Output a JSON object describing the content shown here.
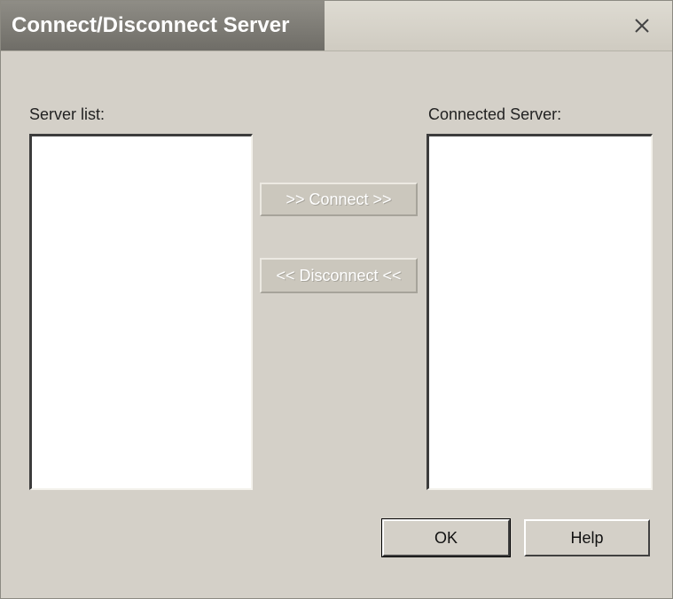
{
  "window": {
    "title": "Connect/Disconnect Server",
    "close_label": "×"
  },
  "left_list": {
    "label": "Server list:",
    "items": []
  },
  "right_list": {
    "label": "Connected Server:",
    "items": []
  },
  "buttons": {
    "connect": ">> Connect >>",
    "disconnect": "<< Disconnect <<",
    "ok": "OK",
    "help": "Help"
  },
  "states": {
    "connect_enabled": false,
    "disconnect_enabled": false
  }
}
